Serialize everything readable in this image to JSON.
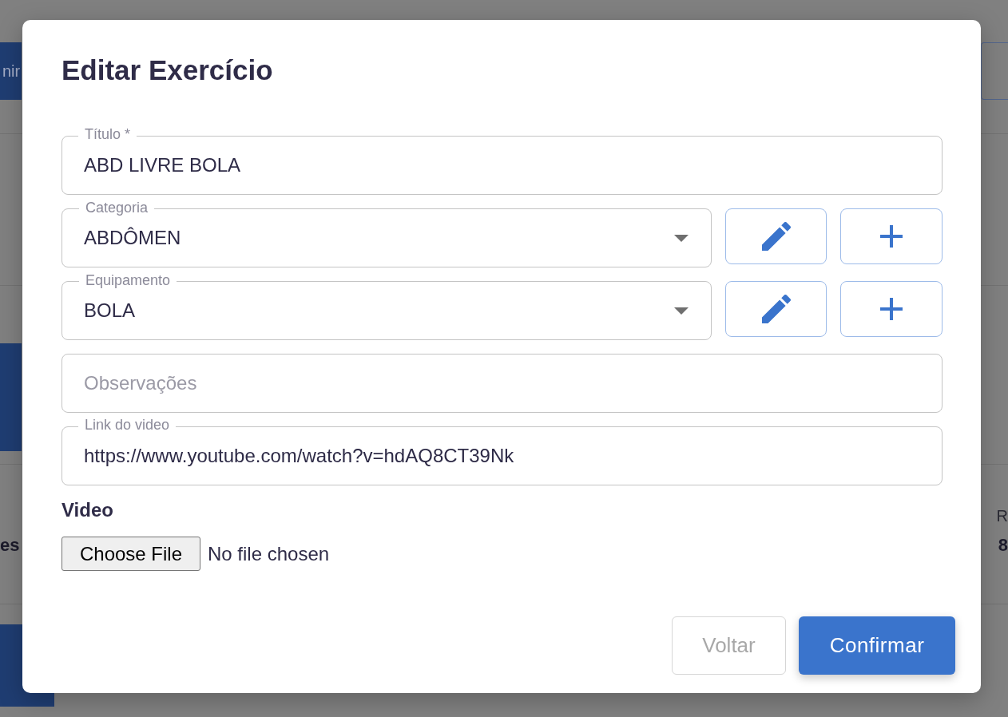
{
  "background_page": {
    "top_left_button": "nir",
    "left_label": "es",
    "right_label": "R",
    "right_value": "8"
  },
  "dialog": {
    "title": "Editar Exercício",
    "fields": [
      {
        "kind": "text",
        "label": "Título *",
        "value": "ABD LIVRE BOLA"
      },
      {
        "kind": "select",
        "label": "Categoria",
        "value": "ABDÔMEN"
      },
      {
        "kind": "select",
        "label": "Equipamento",
        "value": "BOLA"
      },
      {
        "kind": "text",
        "placeholder": "Observações"
      },
      {
        "kind": "text",
        "label": "Link do video",
        "value": "https://www.youtube.com/watch?v=hdAQ8CT39Nk"
      }
    ],
    "file_upload": {
      "label": "Video",
      "button": "Choose File",
      "status": "No file chosen"
    },
    "buttons": [
      {
        "label": "Voltar",
        "kind": "outlined",
        "disabled": true
      },
      {
        "label": "Confirmar",
        "kind": "contained",
        "disabled": false
      }
    ]
  }
}
